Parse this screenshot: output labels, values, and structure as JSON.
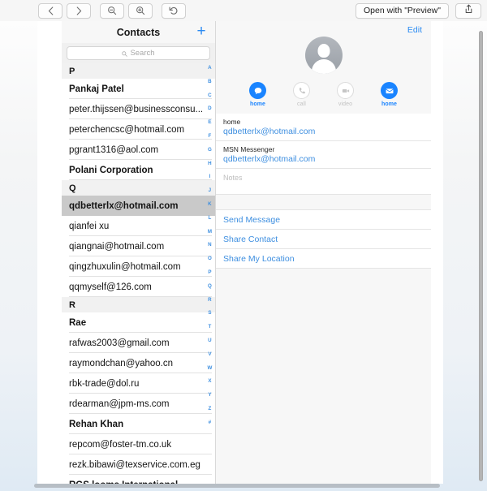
{
  "toolbar": {
    "back_icon": "chevron-left-icon",
    "forward_icon": "chevron-right-icon",
    "zoom_out_icon": "magnifier-minus-icon",
    "zoom_in_icon": "magnifier-plus-icon",
    "rotate_icon": "rotate-counterclockwise-icon",
    "open_with_label": "Open with \"Preview\"",
    "share_icon": "share-upload-icon"
  },
  "contacts": {
    "header": {
      "title": "Contacts",
      "add_label": "+",
      "add_icon": "plus-icon"
    },
    "search": {
      "placeholder": "Search",
      "value": "",
      "icon": "search-icon"
    },
    "rows": [
      {
        "label": "P",
        "type": "section"
      },
      {
        "label": "Pankaj Patel",
        "type": "contact",
        "bold": true
      },
      {
        "label": "peter.thijssen@businessconsu...",
        "type": "contact",
        "bold": false
      },
      {
        "label": "peterchencsc@hotmail.com",
        "type": "contact",
        "bold": false
      },
      {
        "label": "pgrant1316@aol.com",
        "type": "contact",
        "bold": false
      },
      {
        "label": "Polani Corporation",
        "type": "contact",
        "bold": true
      },
      {
        "label": "Q",
        "type": "section"
      },
      {
        "label": "qdbetterlx@hotmail.com",
        "type": "contact",
        "selected": true,
        "bold": true
      },
      {
        "label": "qianfei xu",
        "type": "contact",
        "bold": false
      },
      {
        "label": "qiangnai@hotmail.com",
        "type": "contact",
        "bold": false
      },
      {
        "label": "qingzhuxulin@hotmail.com",
        "type": "contact",
        "bold": false
      },
      {
        "label": "qqmyself@126.com",
        "type": "contact",
        "bold": false
      },
      {
        "label": "R",
        "type": "section"
      },
      {
        "label": "Rae",
        "type": "contact",
        "bold": true
      },
      {
        "label": "rafwas2003@gmail.com",
        "type": "contact",
        "bold": false
      },
      {
        "label": "raymondchan@yahoo.cn",
        "type": "contact",
        "bold": false
      },
      {
        "label": "rbk-trade@dol.ru",
        "type": "contact",
        "bold": false
      },
      {
        "label": "rdearman@jpm-ms.com",
        "type": "contact",
        "bold": false
      },
      {
        "label": "Rehan Khan",
        "type": "contact",
        "bold": true
      },
      {
        "label": "repcom@foster-tm.co.uk",
        "type": "contact",
        "bold": false
      },
      {
        "label": "rezk.bibawi@texservice.com.eg",
        "type": "contact",
        "bold": false
      },
      {
        "label": "RGS looms International",
        "type": "contact",
        "bold": true
      }
    ],
    "alpha_index": [
      "A",
      "B",
      "C",
      "D",
      "E",
      "F",
      "G",
      "H",
      "I",
      "J",
      "K",
      "L",
      "M",
      "N",
      "O",
      "P",
      "Q",
      "R",
      "S",
      "T",
      "U",
      "V",
      "W",
      "X",
      "Y",
      "Z",
      "#"
    ]
  },
  "detail": {
    "edit_label": "Edit",
    "avatar_icon": "person-placeholder-icon",
    "actions": [
      {
        "label": "home",
        "icon": "message-bubble-icon",
        "enabled": true
      },
      {
        "label": "call",
        "icon": "phone-icon",
        "enabled": false
      },
      {
        "label": "video",
        "icon": "video-camera-icon",
        "enabled": false
      },
      {
        "label": "home",
        "icon": "mail-envelope-icon",
        "enabled": true
      }
    ],
    "fields": [
      {
        "label": "home",
        "value": "qdbetterlx@hotmail.com"
      },
      {
        "label": "MSN Messenger",
        "value": "qdbetterlx@hotmail.com"
      }
    ],
    "notes_placeholder": "Notes",
    "links": [
      "Send Message",
      "Share Contact",
      "Share My Location"
    ]
  },
  "colors": {
    "accent_blue": "#1a84ff",
    "link_blue": "#3e8fe0",
    "selected_row": "#c9c9c9",
    "section_bg": "#f1f1f1"
  }
}
